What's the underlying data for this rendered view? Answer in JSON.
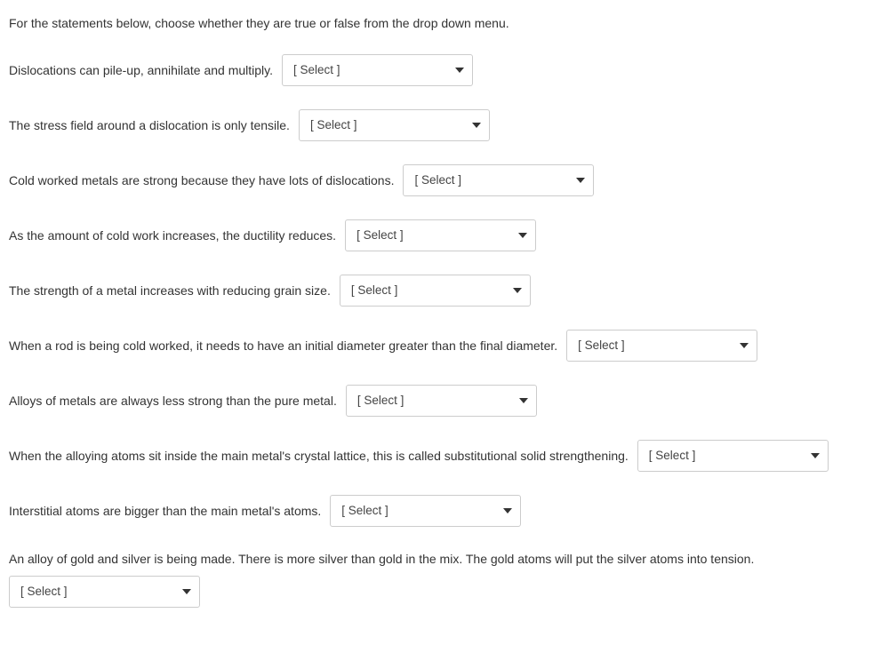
{
  "instructions": "For the statements below, choose whether they are true or false from the drop down menu.",
  "select_placeholder": "[ Select ]",
  "questions": [
    {
      "text": "Dislocations can pile-up, annihilate and multiply."
    },
    {
      "text": "The stress field around a dislocation is only tensile."
    },
    {
      "text": "Cold worked metals are strong because they have lots of dislocations."
    },
    {
      "text": "As the amount of cold work increases, the ductility reduces."
    },
    {
      "text": "The strength of a metal increases with reducing grain size."
    },
    {
      "text": "When a rod is being cold worked, it needs to have an initial diameter greater than the final diameter."
    },
    {
      "text": "Alloys of metals are always less strong than the pure metal."
    },
    {
      "text": "When the alloying atoms sit inside the main metal's crystal lattice, this is called substitutional solid strengthening."
    },
    {
      "text": "Interstitial atoms are bigger than the main metal's atoms."
    },
    {
      "text": "An alloy of gold and silver is being made. There is more silver than gold in the mix. The gold atoms will put the silver atoms into tension."
    }
  ]
}
